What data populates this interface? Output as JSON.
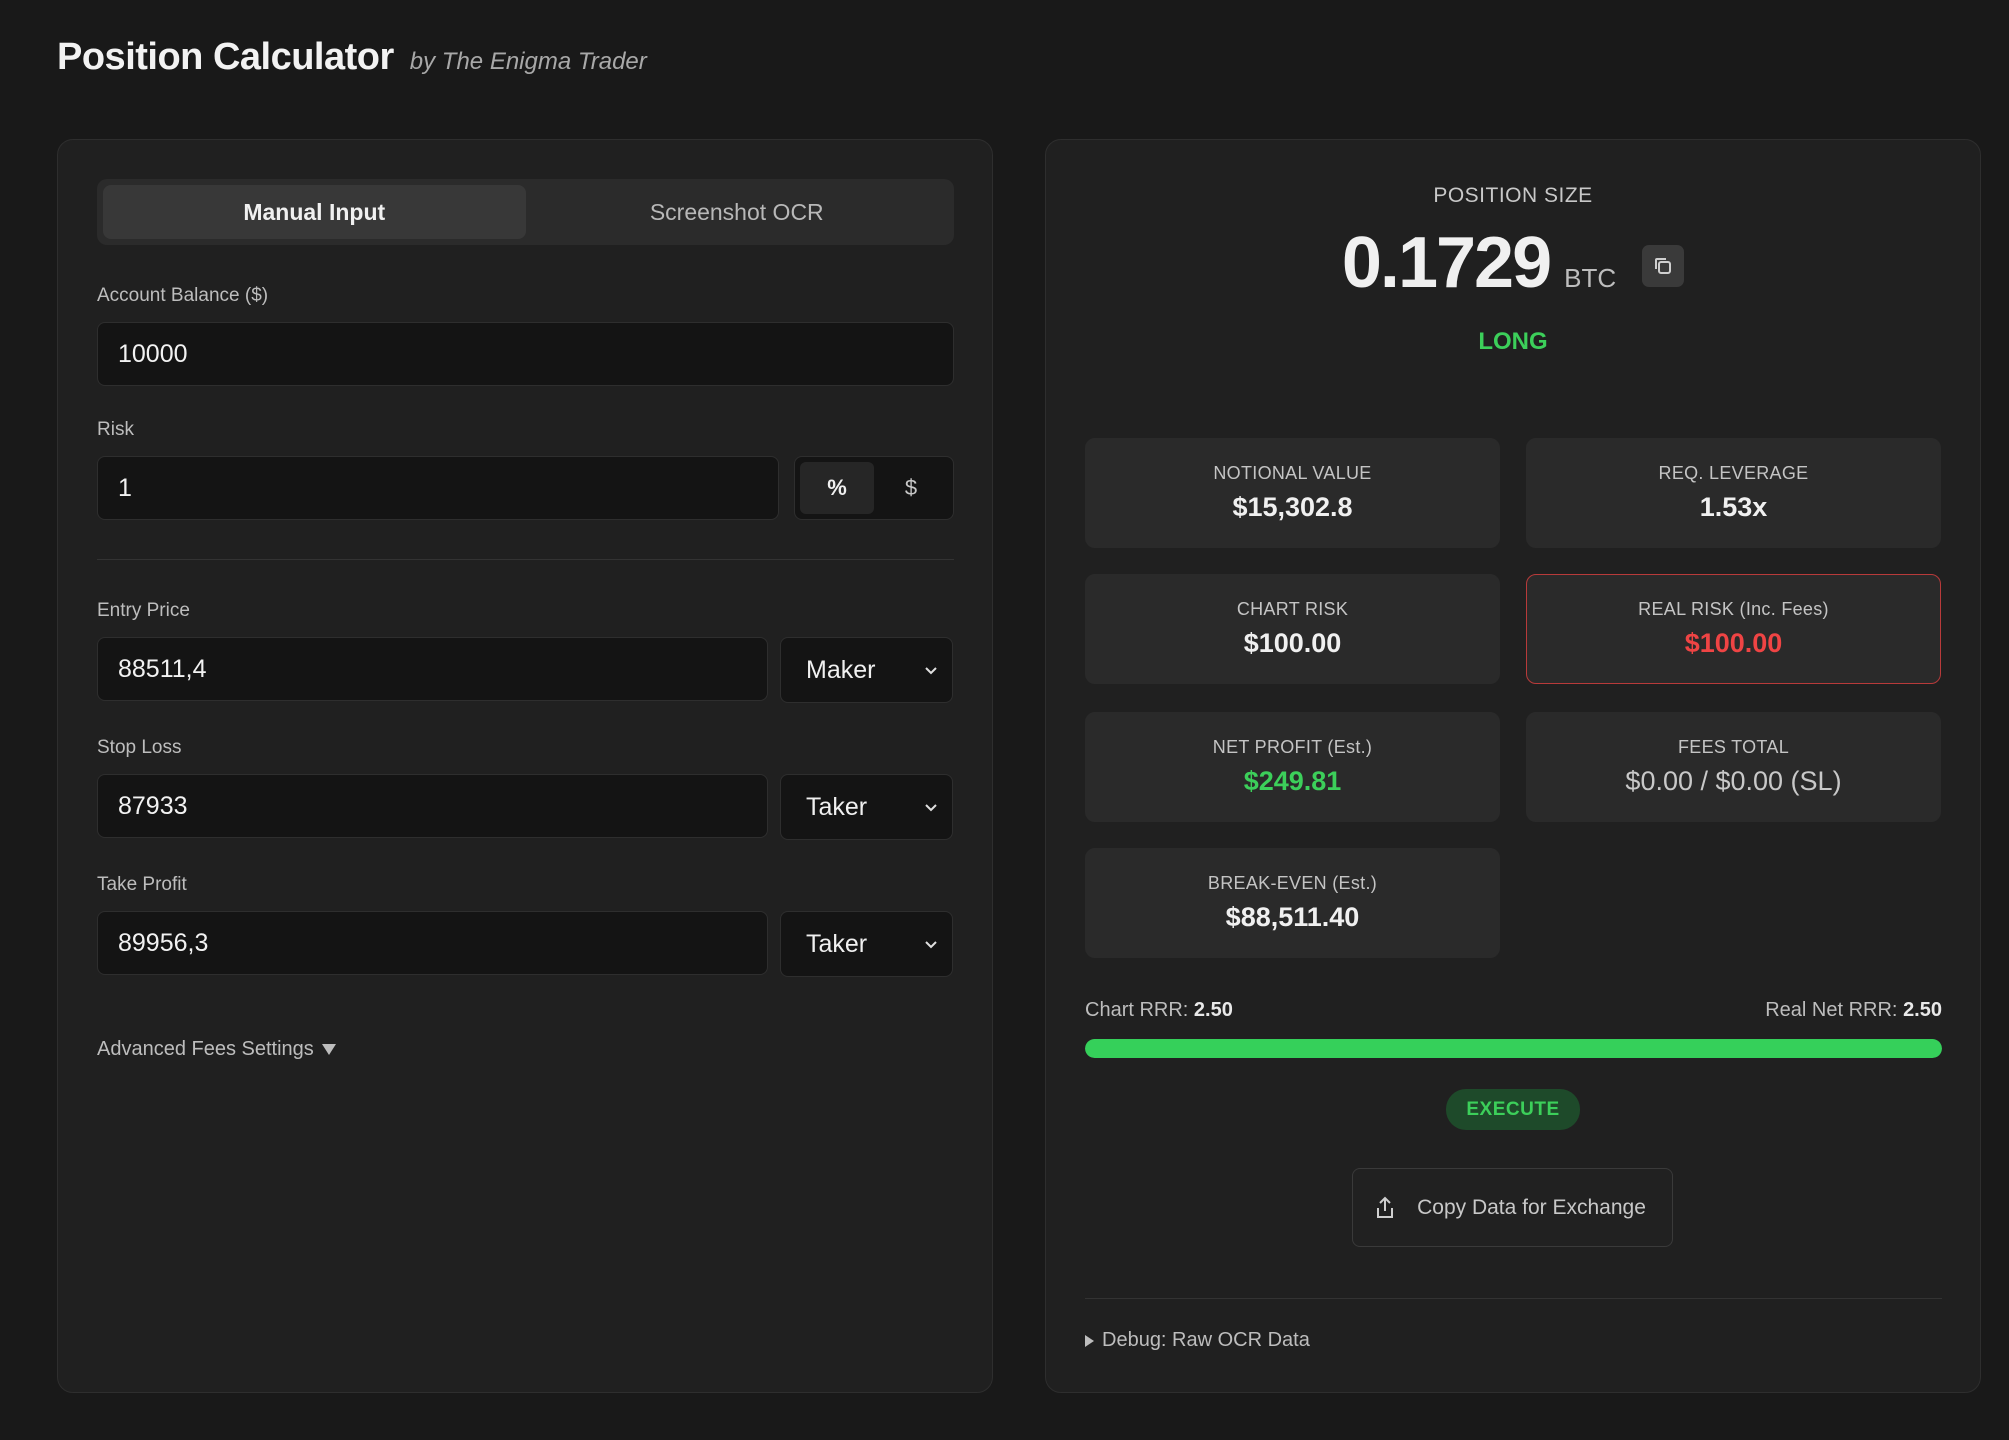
{
  "header": {
    "title": "Position Calculator",
    "byline": "by The Enigma Trader"
  },
  "tabs": [
    {
      "label": "Manual Input",
      "active": true
    },
    {
      "label": "Screenshot OCR",
      "active": false
    }
  ],
  "form": {
    "account_balance": {
      "label": "Account Balance ($)",
      "value": "10000"
    },
    "risk": {
      "label": "Risk",
      "value": "1",
      "modes": [
        "%",
        "$"
      ],
      "selected_mode": "%"
    },
    "entry_price": {
      "label": "Entry Price",
      "value": "88511,4",
      "order_type": "Maker"
    },
    "stop_loss": {
      "label": "Stop Loss",
      "value": "87933",
      "order_type": "Taker"
    },
    "take_profit": {
      "label": "Take Profit",
      "value": "89956,3",
      "order_type": "Taker"
    },
    "advanced_fees_label": "Advanced Fees Settings"
  },
  "result": {
    "position_size_label": "POSITION SIZE",
    "position_size_value": "0.1729",
    "position_size_unit": "BTC",
    "direction": "LONG",
    "cards": {
      "notional": {
        "label": "NOTIONAL VALUE",
        "value": "$15,302.8"
      },
      "leverage": {
        "label": "REQ. LEVERAGE",
        "value": "1.53x"
      },
      "chart_risk": {
        "label": "CHART RISK",
        "value": "$100.00"
      },
      "real_risk": {
        "label": "REAL RISK (Inc. Fees)",
        "value": "$100.00"
      },
      "net_profit": {
        "label": "NET PROFIT (Est.)",
        "value": "$249.81"
      },
      "fees_total": {
        "label": "FEES TOTAL",
        "value": "$0.00 / $0.00 (SL)"
      },
      "break_even": {
        "label": "BREAK-EVEN (Est.)",
        "value": "$88,511.40"
      }
    },
    "chart_rrr_label": "Chart RRR:",
    "chart_rrr_value": "2.50",
    "real_rrr_label": "Real Net RRR:",
    "real_rrr_value": "2.50",
    "rrr_bar_fill": 1.0,
    "execute_label": "EXECUTE",
    "copy_exchange_label": "Copy Data for Exchange",
    "debug_label": "Debug: Raw OCR Data"
  },
  "colors": {
    "accent_green": "#3ccf5a",
    "danger_red": "#ef4444",
    "background": "#191919",
    "panel": "#202020"
  },
  "icons": [
    "copy-icon",
    "share-upload-icon",
    "chevron-down-icon",
    "triangle-down-icon",
    "triangle-right-icon"
  ]
}
